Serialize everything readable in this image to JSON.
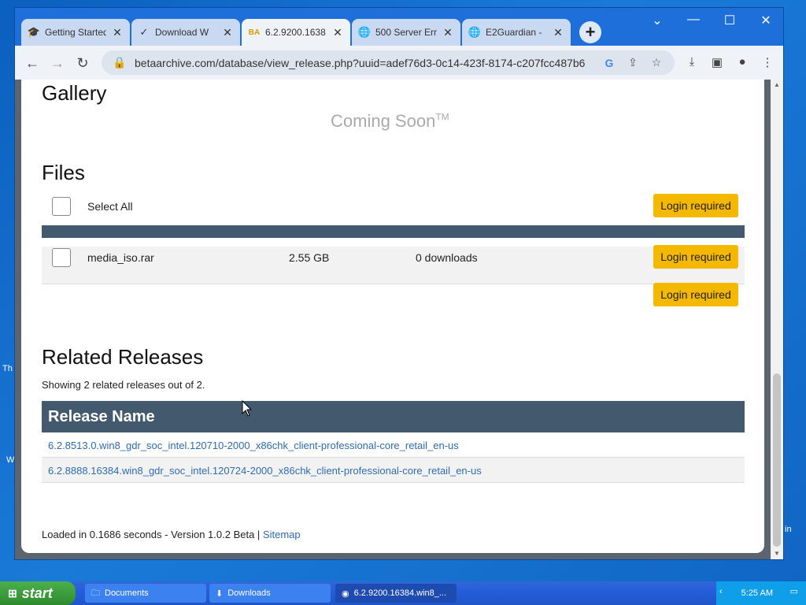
{
  "browser": {
    "tabs": [
      {
        "label": "Getting Started",
        "icon": "graduation-cap-icon"
      },
      {
        "label": "Download W",
        "icon": "logo-icon"
      },
      {
        "label": "6.2.9200.1638",
        "icon": "betaarchive-icon",
        "active": true
      },
      {
        "label": "500 Server Err",
        "icon": "globe-icon"
      },
      {
        "label": "E2Guardian -",
        "icon": "globe-icon"
      }
    ],
    "url": "betaarchive.com/database/view_release.php?uuid=adef76d3-0c14-423f-8174-c207fcc487b6"
  },
  "page": {
    "gallery_title": "Gallery",
    "coming_soon": "Coming Soon",
    "trademark": "TM",
    "files_title": "Files",
    "select_all": "Select All",
    "login_required": "Login required",
    "file": {
      "name": "media_iso.rar",
      "size": "2.55 GB",
      "downloads": "0 downloads"
    },
    "related_title": "Related Releases",
    "related_count": "Showing 2 related releases out of 2.",
    "release_name_header": "Release Name",
    "releases": [
      "6.2.8513.0.win8_gdr_soc_intel.120710-2000_x86chk_client-professional-core_retail_en-us",
      "6.2.8888.16384.win8_gdr_soc_intel.120724-2000_x86chk_client-professional-core_retail_en-us"
    ],
    "footer_text": "Loaded in 0.1686 seconds - Version 1.0.2 Beta | ",
    "footer_link": "Sitemap"
  },
  "taskbar": {
    "start_label": "start",
    "tasks": [
      "Documents",
      "Downloads",
      "6.2.9200.16384.win8_..."
    ],
    "time": "5:25 AM"
  },
  "desktop": {
    "fragments": [
      "Th",
      "W",
      "in"
    ]
  }
}
